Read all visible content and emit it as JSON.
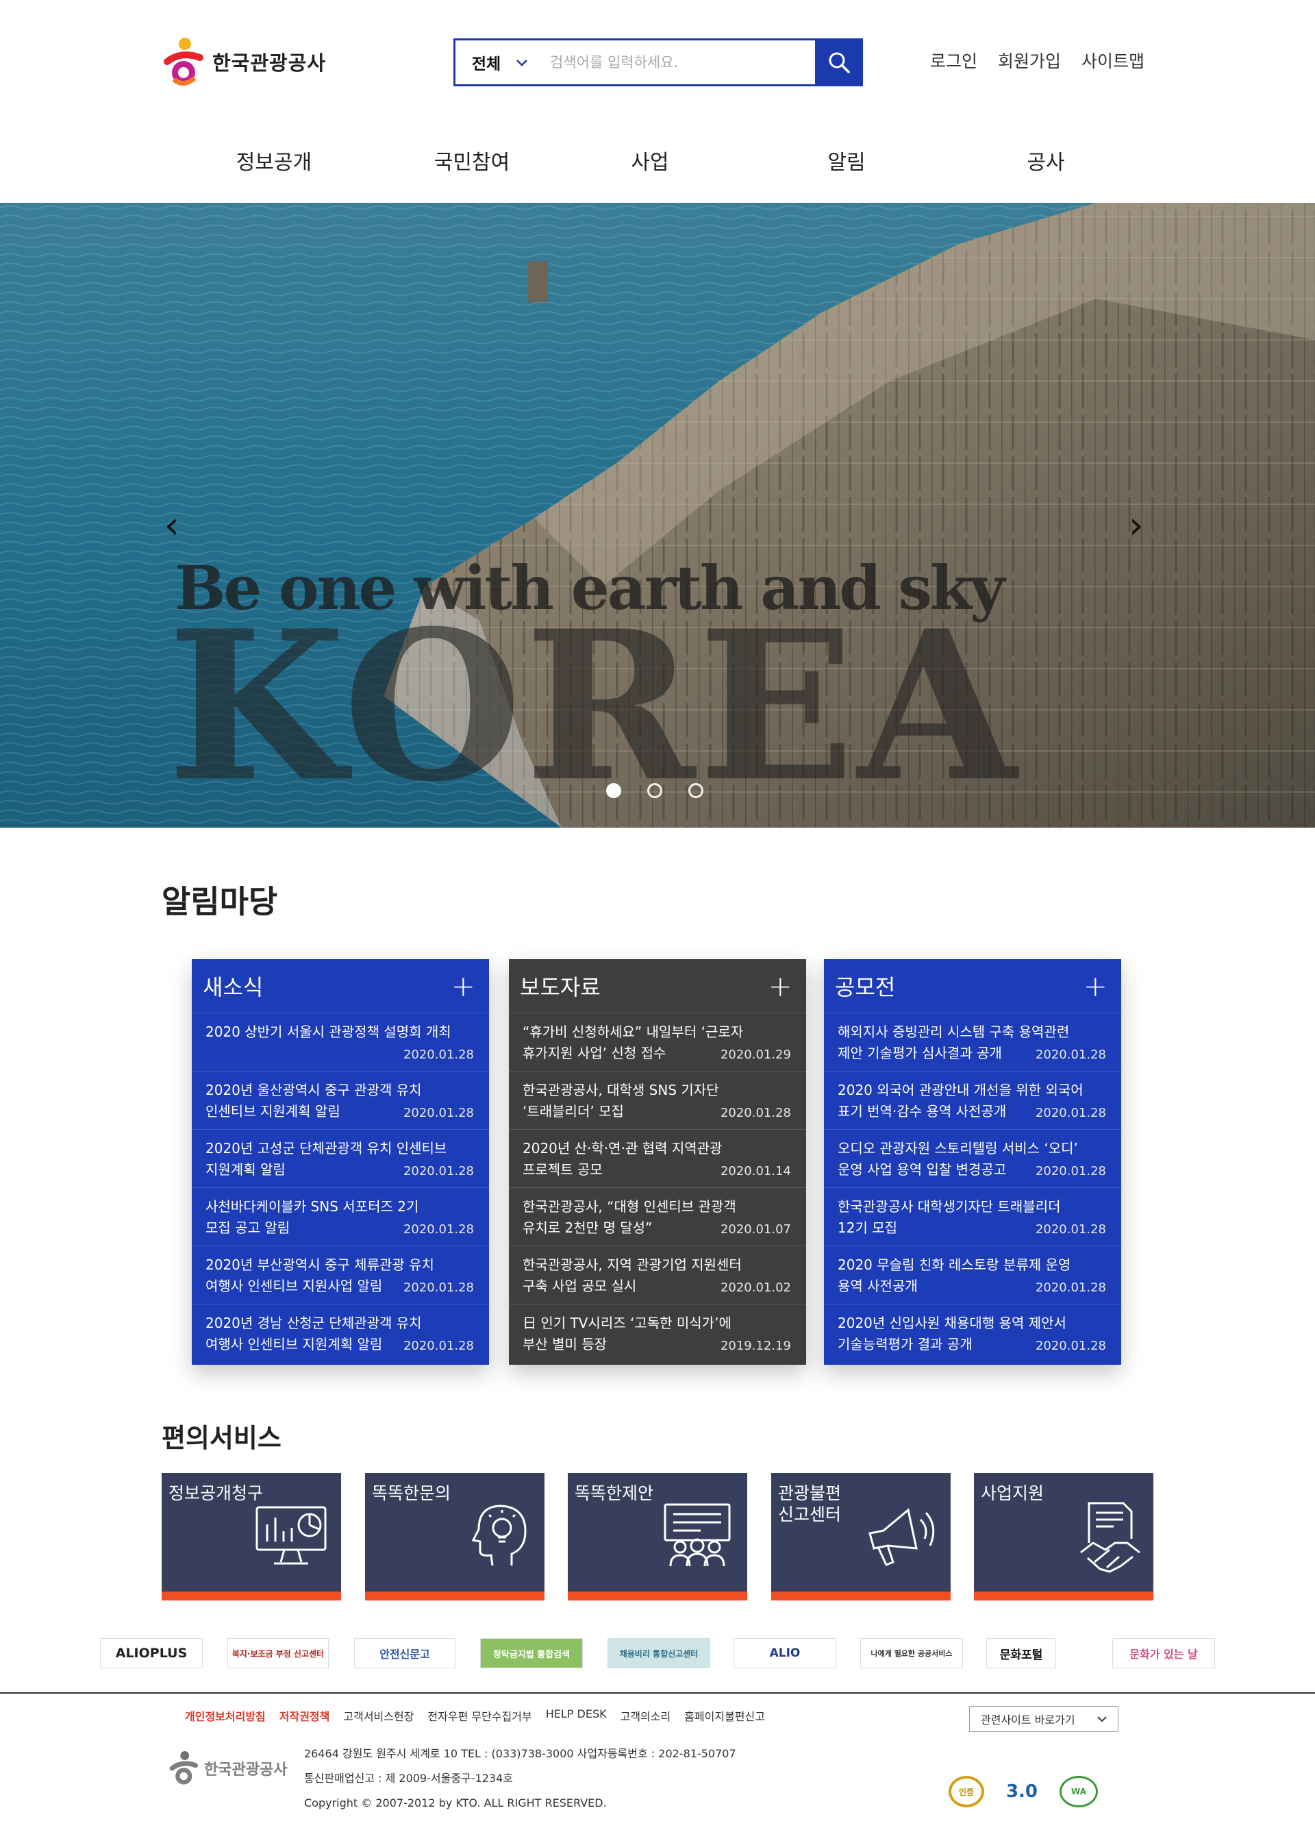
{
  "header": {
    "logo_text": "한국관광공사",
    "search": {
      "scope": "전체",
      "placeholder": "검색어를 입력하세요."
    },
    "util": [
      "로그인",
      "회원가입",
      "사이트맵"
    ]
  },
  "gnb": [
    "정보공개",
    "국민참여",
    "사업",
    "알림",
    "공사"
  ],
  "hero": {
    "subtitle": "Be one with earth and sky",
    "title": "KOREA",
    "prev": "‹",
    "next": "›",
    "slides": 3,
    "active_slide": 1
  },
  "notice": {
    "title": "알림마당",
    "boards": [
      {
        "title": "새소식",
        "plus": "+",
        "items": [
          {
            "line1": "2020 상반기 서울시 관광정책 설명회 개최",
            "line2": "",
            "date": "2020.01.28"
          },
          {
            "line1": "2020년 울산광역시 중구 관광객 유치",
            "line2": "인센티브 지원계획 알림",
            "date": "2020.01.28"
          },
          {
            "line1": "2020년 고성군 단체관광객 유치 인센티브",
            "line2": "지원계획 알림",
            "date": "2020.01.28"
          },
          {
            "line1": "사천바다케이블카 SNS 서포터즈 2기",
            "line2": "모집 공고 알림",
            "date": "2020.01.28"
          },
          {
            "line1": "2020년 부산광역시 중구 체류관광 유치",
            "line2": "여행사 인센티브 지원사업 알림",
            "date": "2020.01.28"
          },
          {
            "line1": "2020년 경남 산청군 단체관광객 유치",
            "line2": "여행사 인센티브 지원계획 알림",
            "date": "2020.01.28"
          }
        ]
      },
      {
        "title": "보도자료",
        "plus": "+",
        "items": [
          {
            "line1": "“휴가비 신청하세요” 내일부터 ‘근로자",
            "line2": "휴가지원 사업’ 신청 접수",
            "date": "2020.01.29"
          },
          {
            "line1": "한국관광공사, 대학생 SNS 기자단",
            "line2": "‘트래블리더’ 모집",
            "date": "2020.01.28"
          },
          {
            "line1": "2020년 산·학·연·관 협력 지역관광",
            "line2": "프로젝트 공모",
            "date": "2020.01.14"
          },
          {
            "line1": "한국관광공사, “대형 인센티브 관광객",
            "line2": "유치로 2천만 명 달성”",
            "date": "2020.01.07"
          },
          {
            "line1": "한국관광공사, 지역 관광기업 지원센터",
            "line2": "구축 사업 공모 실시",
            "date": "2020.01.02"
          },
          {
            "line1": "日 인기 TV시리즈 ‘고독한 미식가’에",
            "line2": "부산 별미 등장",
            "date": "2019.12.19"
          }
        ]
      },
      {
        "title": "공모전",
        "plus": "+",
        "items": [
          {
            "line1": "해외지사 증빙관리 시스템 구축 용역관련",
            "line2": "제안 기술평가 심사결과 공개",
            "date": "2020.01.28"
          },
          {
            "line1": "2020 외국어 관광안내 개선을 위한 외국어",
            "line2": "표기 번역·감수 용역 사전공개",
            "date": "2020.01.28"
          },
          {
            "line1": "오디오 관광자원 스토리텔링 서비스 ‘오디’",
            "line2": "운영 사업 용역 입찰 변경공고",
            "date": "2020.01.28"
          },
          {
            "line1": "한국관광공사 대학생기자단 트래블리더",
            "line2": "12기 모집",
            "date": "2020.01.28"
          },
          {
            "line1": "2020 무슬림 친화 레스토랑 분류제 운영",
            "line2": "용역 사전공개",
            "date": "2020.01.28"
          },
          {
            "line1": "2020년 신입사원 채용대행 용역 제안서",
            "line2": "기술능력평가 결과 공개",
            "date": "2020.01.28"
          }
        ]
      }
    ]
  },
  "services": {
    "title": "편의서비스",
    "items": [
      {
        "line1": "정보공개청구",
        "line2": "",
        "icon": "monitor-chart-icon"
      },
      {
        "line1": "똑똑한문의",
        "line2": "",
        "icon": "head-bulb-icon"
      },
      {
        "line1": "똑똑한제안",
        "line2": "",
        "icon": "presentation-group-icon"
      },
      {
        "line1": "관광불편",
        "line2": "신고센터",
        "icon": "megaphone-icon"
      },
      {
        "line1": "사업지원",
        "line2": "",
        "icon": "handshake-contract-icon"
      }
    ]
  },
  "banners": [
    "ALIOPLUS",
    "복지·보조금 부정 신고센터",
    "안전신문고",
    "청탁금지법 통합검색",
    "채용비리 통합신고센터",
    "ALIO",
    "나에게 필요한 공공서비스",
    "문화포털",
    "문화가 있는 날"
  ],
  "footer": {
    "links": [
      {
        "label": "개인정보처리방침",
        "red": true
      },
      {
        "label": "저작권정책",
        "red": true
      },
      {
        "label": "고객서비스헌장",
        "red": false
      },
      {
        "label": "전자우편 무단수집거부",
        "red": false
      },
      {
        "label": "HELP DESK",
        "red": false
      },
      {
        "label": "고객의소리",
        "red": false
      },
      {
        "label": "홈페이지불편신고",
        "red": false
      }
    ],
    "related": "관련사이트 바로가기",
    "logo_text": "한국관광공사",
    "address": "26464 강원도 원주시 세계로 10 TEL : (033)738-3000 사업자등록번호 : 202-81-50707",
    "mail_order": "통신판매업신고 : 제 2009-서울중구-1234호",
    "copyright": "Copyright © 2007-2012 by KTO. ALL RIGHT RESERVED.",
    "certs": [
      "인증",
      "3.0",
      "WA"
    ]
  },
  "colors": {
    "accent_blue": "#1d3cb8",
    "board_gray": "#3e3e3e",
    "service_navy": "#373f5c",
    "service_orange": "#f04e23"
  }
}
